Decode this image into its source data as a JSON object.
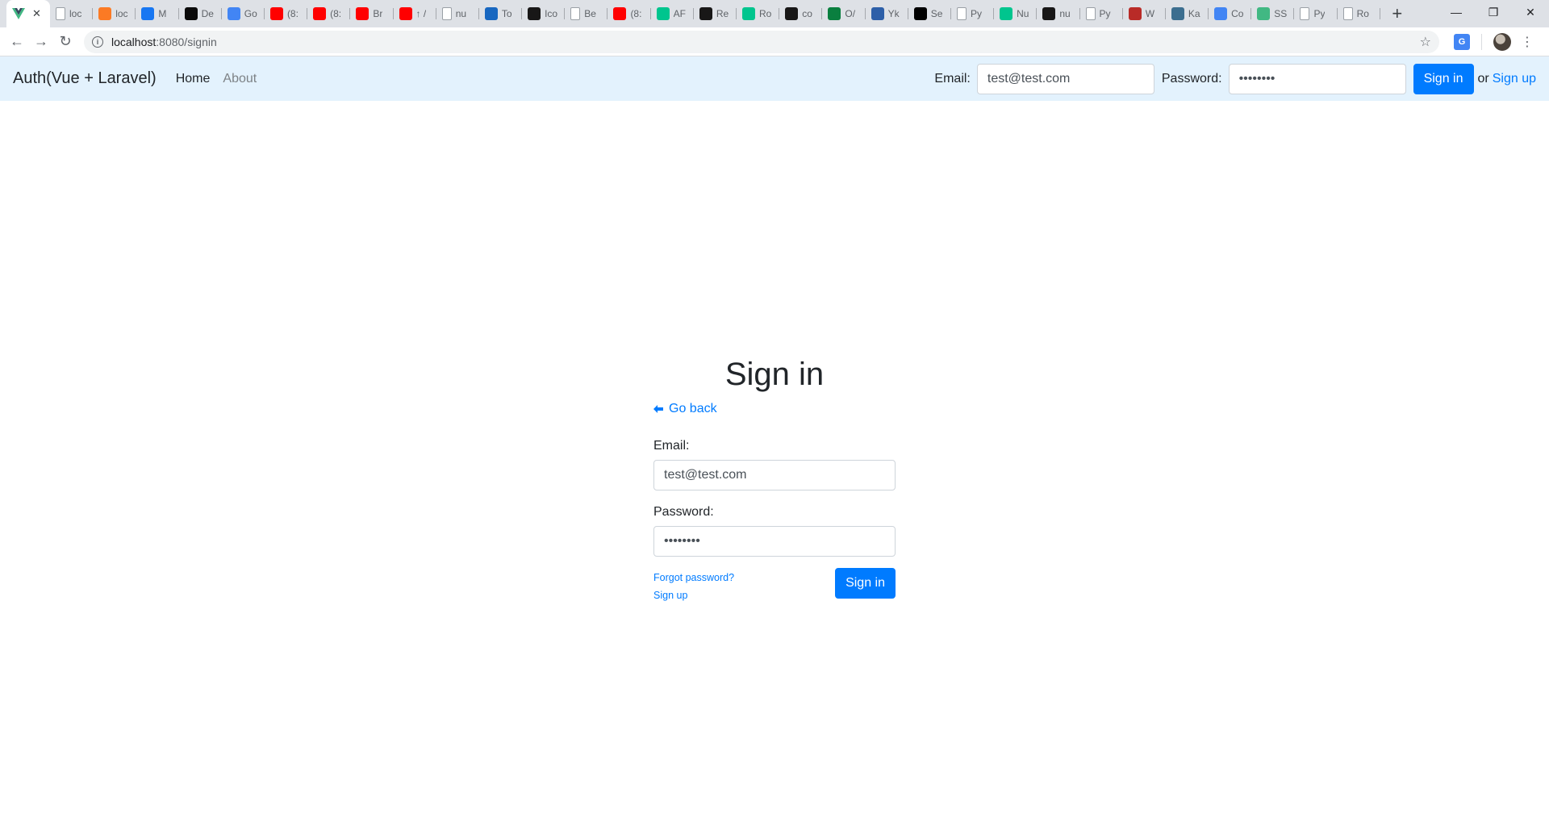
{
  "browser": {
    "active_tab_favicon": "vue-icon",
    "tabs": [
      {
        "title": "loc",
        "icon": "page-icon",
        "color": "#ffffff"
      },
      {
        "title": "loc",
        "icon": "xampp-icon",
        "color": "#fb7a24"
      },
      {
        "title": "M",
        "icon": "facebook-icon",
        "color": "#1877f2"
      },
      {
        "title": "De",
        "icon": "devto-icon",
        "color": "#0a0a0a"
      },
      {
        "title": "Go",
        "icon": "google-translate-icon",
        "color": "#4285f4"
      },
      {
        "title": "(8:",
        "icon": "youtube-icon",
        "color": "#ff0000"
      },
      {
        "title": "(8:",
        "icon": "youtube-icon",
        "color": "#ff0000"
      },
      {
        "title": "Br",
        "icon": "youtube-icon",
        "color": "#ff0000"
      },
      {
        "title": "↑ /",
        "icon": "youtube-icon",
        "color": "#ff0000"
      },
      {
        "title": "nu",
        "icon": "wikipedia-icon",
        "color": "#ffffff"
      },
      {
        "title": "To",
        "icon": "vuetify-icon",
        "color": "#1867c0"
      },
      {
        "title": "Ico",
        "icon": "github-icon",
        "color": "#181717"
      },
      {
        "title": "Be",
        "icon": "page-icon",
        "color": "#ffffff"
      },
      {
        "title": "(8:",
        "icon": "youtube-icon",
        "color": "#ff0000"
      },
      {
        "title": "AF",
        "icon": "nuxt-icon",
        "color": "#00c58e"
      },
      {
        "title": "Re",
        "icon": "github-icon",
        "color": "#181717"
      },
      {
        "title": "Ro",
        "icon": "nuxt-icon",
        "color": "#00c58e"
      },
      {
        "title": "co",
        "icon": "github-icon",
        "color": "#181717"
      },
      {
        "title": "O/",
        "icon": "code-icon",
        "color": "#0a7f3f"
      },
      {
        "title": "Yk",
        "icon": "stackoverflow-icon",
        "color": "#2d5fa8"
      },
      {
        "title": "Se",
        "icon": "medium-icon",
        "color": "#000000"
      },
      {
        "title": "Py",
        "icon": "page-icon",
        "color": "#ffffff"
      },
      {
        "title": "Nu",
        "icon": "nuxt-icon",
        "color": "#00c58e"
      },
      {
        "title": "nu",
        "icon": "github-icon",
        "color": "#181717"
      },
      {
        "title": "Py",
        "icon": "page-icon",
        "color": "#ffffff"
      },
      {
        "title": "W",
        "icon": "quora-icon",
        "color": "#b92b27"
      },
      {
        "title": "Ka",
        "icon": "hackernoon-icon",
        "color": "#3c6e8f"
      },
      {
        "title": "Co",
        "icon": "chrome-icon",
        "color": "#4285f4"
      },
      {
        "title": "SS",
        "icon": "vue-icon",
        "color": "#41b883"
      },
      {
        "title": "Py",
        "icon": "page-icon",
        "color": "#ffffff"
      },
      {
        "title": "Ro",
        "icon": "send-icon",
        "color": "#ffffff"
      }
    ],
    "new_tab": "+",
    "url_host": "localhost",
    "url_path": ":8080/signin"
  },
  "navbar": {
    "brand": "Auth(Vue + Laravel)",
    "links": {
      "home": "Home",
      "about": "About"
    },
    "email_label": "Email:",
    "email_value": "test@test.com",
    "password_label": "Password:",
    "password_value": "••••••••",
    "signin_button": "Sign in",
    "or_text": "or",
    "signup_link": "Sign up"
  },
  "signin": {
    "title": "Sign in",
    "go_back": "Go back",
    "email_label": "Email:",
    "email_value": "test@test.com",
    "password_label": "Password:",
    "password_value": "••••••••",
    "forgot_password": "Forgot password?",
    "signup_link": "Sign up",
    "signin_button": "Sign in"
  },
  "colors": {
    "primary": "#007bff",
    "navbar_bg": "#e3f2fd",
    "tabstrip_bg": "#dee1e6"
  }
}
